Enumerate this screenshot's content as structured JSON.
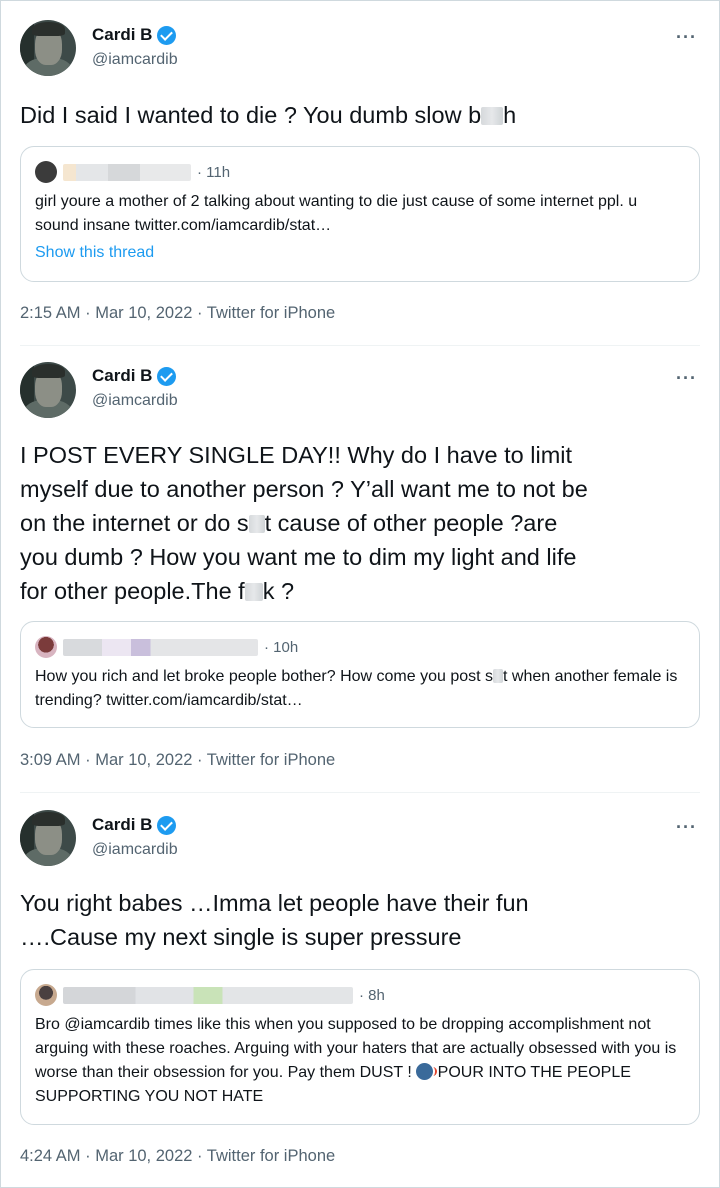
{
  "tweets": [
    {
      "name": "Cardi B",
      "handle": "@iamcardib",
      "text_parts": [
        "Did I said I wanted to die ? You dumb slow b",
        "h"
      ],
      "quote": {
        "time": "· 11h",
        "text": "girl youre a mother of 2 talking about wanting to die just cause of some internet ppl. u sound insane twitter.com/iamcardib/stat…",
        "link": "Show this thread"
      },
      "meta": "2:15 AM · Mar 10, 2022 · Twitter for iPhone"
    },
    {
      "name": "Cardi B",
      "handle": "@iamcardib",
      "text_lines": [
        "I POST EVERY SINGLE DAY!! Why do I have to limit",
        "myself due to another person ? Y’all want me to not be",
        [
          "on the internet or do s",
          "t cause of other people ?are"
        ],
        "you dumb ? How you want me to dim my light and life",
        [
          "for other people.The f",
          "k ?"
        ]
      ],
      "quote": {
        "time": "· 10h",
        "text_parts": [
          "How you rich and let broke people bother? How come you post s",
          "t when another female is trending? twitter.com/iamcardib/stat…"
        ]
      },
      "meta": "3:09 AM · Mar 10, 2022 · Twitter for iPhone"
    },
    {
      "name": "Cardi B",
      "handle": "@iamcardib",
      "text_lines": [
        "You right babes …Imma let people have their fun",
        "….Cause my next single is super pressure"
      ],
      "quote": {
        "time": "· 8h",
        "text": "Bro @iamcardib times like this when you supposed to be dropping accomplishment not arguing with these roaches. Arguing with your haters that are actually obsessed with you is worse than their obsession for you.   Pay them DUST !",
        "text_tail": " POUR INTO THE PEOPLE SUPPORTING YOU NOT HATE"
      },
      "meta": "4:24 AM · Mar 10, 2022 · Twitter for iPhone"
    }
  ],
  "more_icon": "···",
  "icons": {
    "verified": "verified-badge-icon",
    "more": "more-options-icon",
    "emoji": "speaking-head-emoji"
  },
  "colors": {
    "link": "#1d9bf0",
    "secondary_text": "#536471",
    "border": "#cfd9de"
  }
}
